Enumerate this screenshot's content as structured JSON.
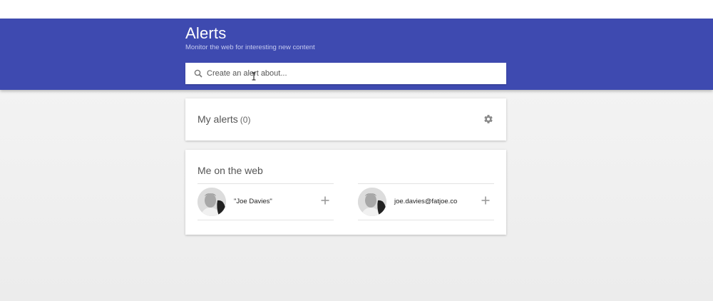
{
  "header": {
    "title": "Alerts",
    "subtitle": "Monitor the web for interesting new content",
    "color": "#3e4ab0"
  },
  "search": {
    "placeholder": "Create an alert about...",
    "icon": "search-icon"
  },
  "my_alerts": {
    "title": "My alerts",
    "count": "(0)",
    "settings_icon": "gear-icon"
  },
  "me_on_web": {
    "title": "Me on the web",
    "items": [
      {
        "label": "\"Joe Davies\"",
        "action_icon": "plus-icon"
      },
      {
        "label": "joe.davies@fatjoe.co",
        "action_icon": "plus-icon"
      }
    ]
  }
}
